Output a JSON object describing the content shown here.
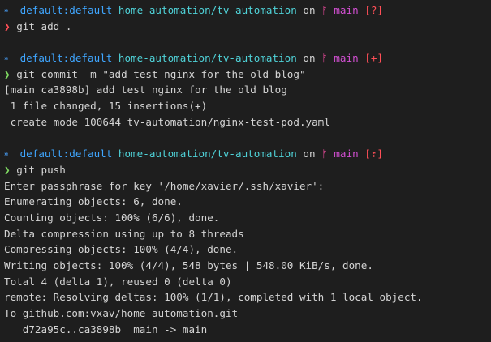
{
  "blocks": [
    {
      "header": {
        "icon": "kubernetes-icon",
        "context": "default:default",
        "path": "home-automation/tv-automation",
        "on": "on",
        "branch_icon": "git-branch-icon",
        "branch": "main",
        "status": "[?]"
      },
      "prompt_symbol": "❯",
      "prompt_state": "error",
      "command": "git add .",
      "output": []
    },
    {
      "header": {
        "icon": "kubernetes-icon",
        "context": "default:default",
        "path": "home-automation/tv-automation",
        "on": "on",
        "branch_icon": "git-branch-icon",
        "branch": "main",
        "status": "[+]"
      },
      "prompt_symbol": "❯",
      "prompt_state": "success",
      "command": "git commit -m \"add test nginx for the old blog\"",
      "output": [
        "[main ca3898b] add test nginx for the old blog",
        " 1 file changed, 15 insertions(+)",
        " create mode 100644 tv-automation/nginx-test-pod.yaml"
      ]
    },
    {
      "header": {
        "icon": "kubernetes-icon",
        "context": "default:default",
        "path": "home-automation/tv-automation",
        "on": "on",
        "branch_icon": "git-branch-icon",
        "branch": "main",
        "status": "[⇡]"
      },
      "prompt_symbol": "❯",
      "prompt_state": "success",
      "command": "git push",
      "output": [
        "Enter passphrase for key '/home/xavier/.ssh/xavier':",
        "Enumerating objects: 6, done.",
        "Counting objects: 100% (6/6), done.",
        "Delta compression using up to 8 threads",
        "Compressing objects: 100% (4/4), done.",
        "Writing objects: 100% (4/4), 548 bytes | 548.00 KiB/s, done.",
        "Total 4 (delta 1), reused 0 (delta 0)",
        "remote: Resolving deltas: 100% (1/1), completed with 1 local object.",
        "To github.com:vxav/home-automation.git",
        "   d72a95c..ca3898b  main -> main"
      ]
    }
  ],
  "colors": {
    "background": "#1e1e1e",
    "context": "#3fa6ff",
    "path": "#4fd2d8",
    "branch": "#d14fd1",
    "status": "#ff4f57",
    "prompt_error": "#ff4f57",
    "prompt_success": "#7fd962",
    "text": "#d4d4d4"
  }
}
